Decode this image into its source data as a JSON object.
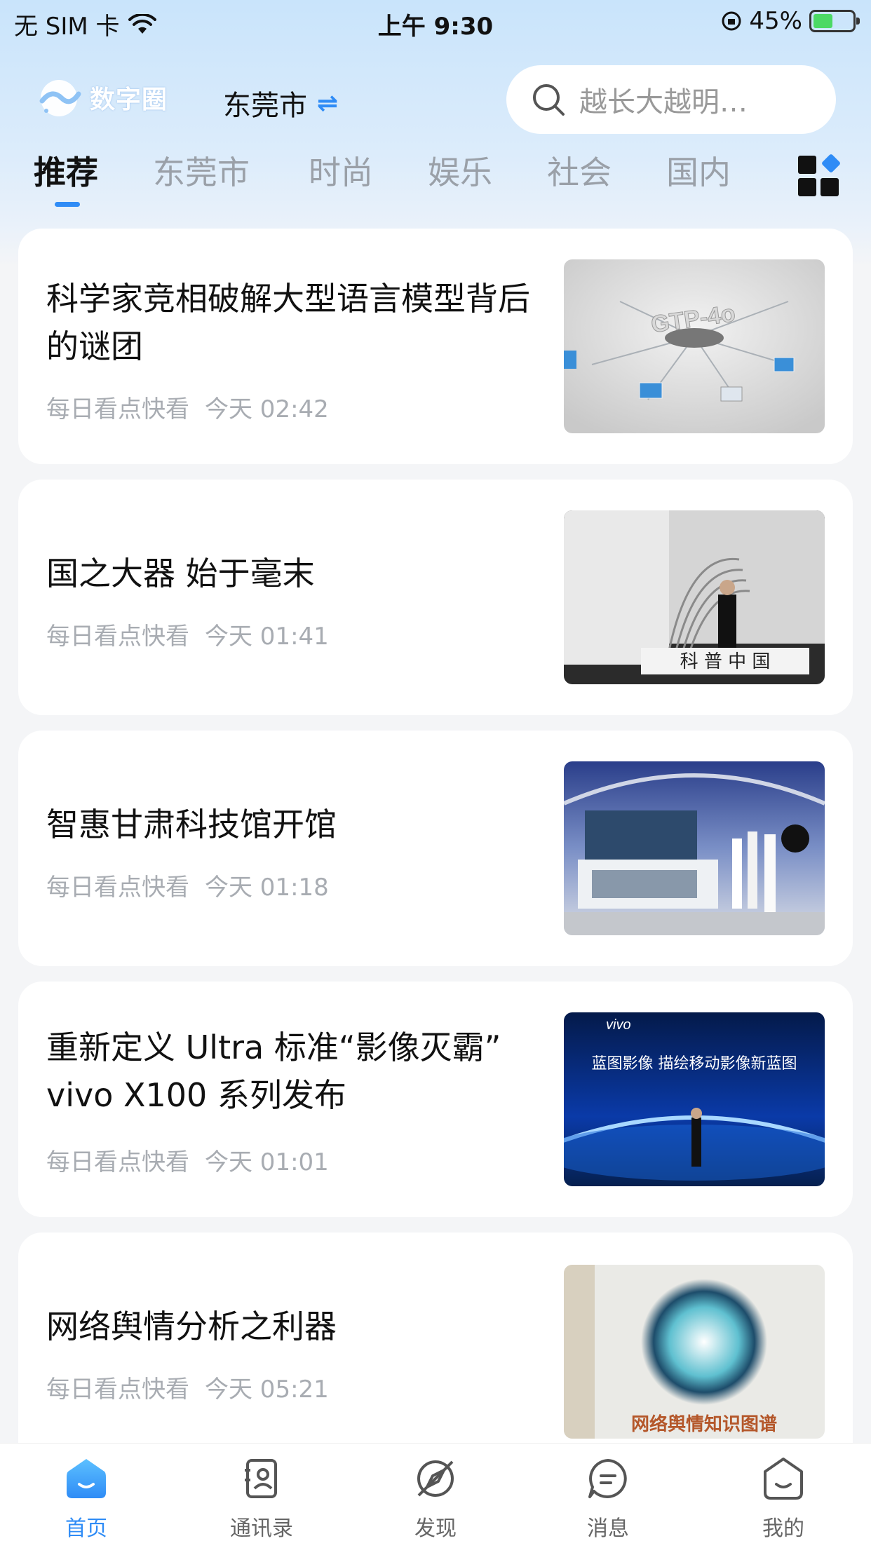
{
  "status_bar": {
    "carrier": "无 SIM 卡",
    "time": "上午 9:30",
    "battery": "45%"
  },
  "header": {
    "logo_text": "数字圈",
    "city": "东莞市",
    "search_placeholder": "越长大越明…"
  },
  "tabs": [
    {
      "label": "推荐"
    },
    {
      "label": "东莞市"
    },
    {
      "label": "时尚"
    },
    {
      "label": "娱乐"
    },
    {
      "label": "社会"
    },
    {
      "label": "国内"
    }
  ],
  "feed": [
    {
      "title": "科学家竞相破解大型语言模型背后的谜团",
      "source": "每日看点快看",
      "time": "今天 02:42",
      "thumb_text": "GTP-4o"
    },
    {
      "title": "国之大器 始于毫末",
      "source": "每日看点快看",
      "time": "今天 01:41",
      "thumb_text": "科 普 中 国"
    },
    {
      "title": "智惠甘肃科技馆开馆",
      "source": "每日看点快看",
      "time": "今天 01:18",
      "thumb_text": ""
    },
    {
      "title": "重新定义 Ultra 标准“影像灭霸” vivo X100 系列发布",
      "source": "每日看点快看",
      "time": "今天 01:01",
      "thumb_text": "蓝图影像 描绘移动影像新蓝图"
    },
    {
      "title": "网络舆情分析之利器",
      "source": "每日看点快看",
      "time": "今天 05:21",
      "thumb_text": "网络舆情知识图谱"
    }
  ],
  "bottom_nav": [
    {
      "label": "首页"
    },
    {
      "label": "通讯录"
    },
    {
      "label": "发现"
    },
    {
      "label": "消息"
    },
    {
      "label": "我的"
    }
  ],
  "colors": {
    "accent": "#2f8cf6"
  }
}
